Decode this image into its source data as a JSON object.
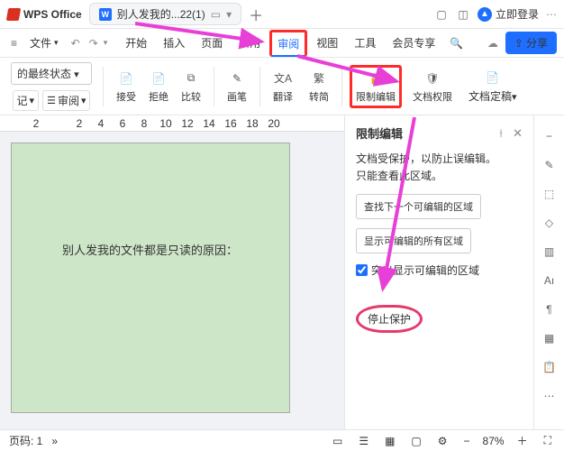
{
  "title": {
    "app": "WPS Office",
    "doc": "别人发我的...22(1)",
    "login": "立即登录"
  },
  "menu": {
    "file": "文件",
    "items": [
      "开始",
      "插入",
      "页面",
      "引用",
      "审阅",
      "视图",
      "工具",
      "会员专享"
    ],
    "activeIndex": 4,
    "share": "分享"
  },
  "ribbon": {
    "status": "的最终状态",
    "track": "记",
    "review": "审阅",
    "accept": "接受",
    "reject": "拒绝",
    "compare": "比较",
    "pen": "画笔",
    "translate": "翻译",
    "convert": "繁",
    "convertBtn": "转简",
    "restrict": "限制编辑",
    "perm": "文档权限",
    "final": "文档定稿"
  },
  "ruler": [
    "2",
    "",
    "2",
    "4",
    "6",
    "8",
    "10",
    "12",
    "14",
    "16",
    "18",
    "20"
  ],
  "doc": {
    "text": "别人发我的文件都是只读的原因："
  },
  "panel": {
    "title": "限制编辑",
    "line1": "文档受保护，以防止误编辑。",
    "line2": "只能查看此区域。",
    "btn1": "查找下一个可编辑的区域",
    "btn2": "显示可编辑的所有区域",
    "chk": "突出显示可编辑的区域",
    "stop": "停止保护"
  },
  "status": {
    "page": "页码: 1",
    "sep": "»",
    "zoom": "87%"
  }
}
